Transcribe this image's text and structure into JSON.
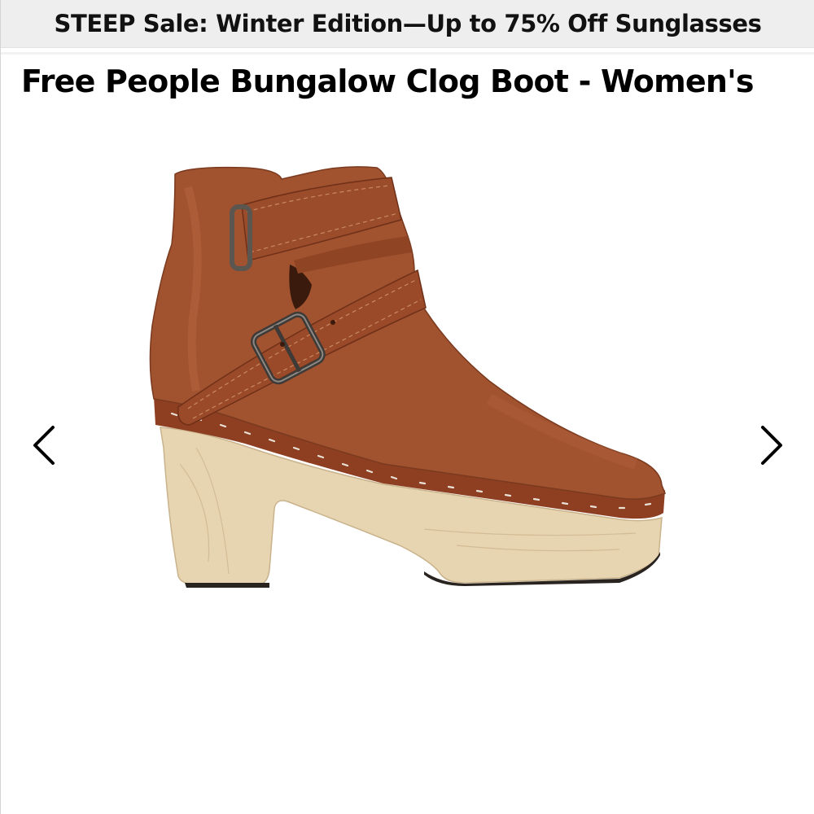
{
  "banner": {
    "text": "STEEP Sale: Winter Edition—Up to 75% Off Sunglasses"
  },
  "product": {
    "title": "Free People Bungalow Clog Boot - Women's"
  },
  "gallery": {
    "prev_icon": "chevron-left-icon",
    "next_icon": "chevron-right-icon"
  },
  "colors": {
    "banner_bg": "#eeeeee",
    "leather": "#a0502e",
    "strap": "#9a4a28",
    "wood": "#e8d6b4",
    "text": "#000000"
  }
}
